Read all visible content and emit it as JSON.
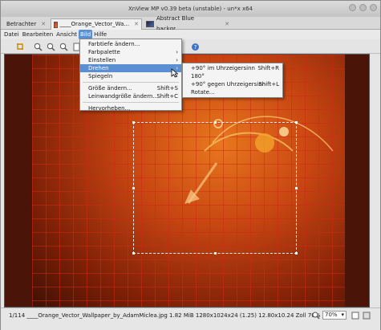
{
  "window": {
    "title": "XnView MP v0.39 beta (unstable) - un*x x64"
  },
  "tabs": [
    {
      "label": "Betrachter",
      "close": "✕"
    },
    {
      "label": "____Orange_Vector_Wa...",
      "close": "✕"
    },
    {
      "label": "Abstract Blue backgr...",
      "close": "✕"
    }
  ],
  "menubar": [
    "Datei",
    "Bearbeiten",
    "Ansicht",
    "Bild",
    "Hilfe"
  ],
  "image_menu": {
    "items": [
      {
        "label": "Farbtiefe ändern..."
      },
      {
        "label": "Farbpalette",
        "arrow": "›"
      },
      {
        "label": "Einstellen",
        "arrow": "›"
      },
      {
        "label": "Drehen",
        "arrow": "›"
      },
      {
        "label": "Spiegeln",
        "arrow": "›"
      },
      {
        "label": "Größe ändern...",
        "shortcut": "Shift+S"
      },
      {
        "label": "Leinwandgröße ändern...",
        "shortcut": "Shift+C"
      },
      {
        "label": "Hervorheben..."
      }
    ]
  },
  "rotate_submenu": {
    "items": [
      {
        "label": "+90° im Uhrzeigersinn",
        "shortcut": "Shift+R"
      },
      {
        "label": "180°",
        "shortcut": ""
      },
      {
        "label": "+90° gegen Uhrzeigersinn",
        "shortcut": "Shift+L"
      },
      {
        "label": "Rotate...",
        "shortcut": ""
      }
    ]
  },
  "status": {
    "text": "1/114   ____Orange_Vector_Wallpaper_by_AdamMiclea.jpg   1.82 MiB   1280x1024x24 (1.25)   12.80x10.24 Zoll   70%",
    "zoom": "70%",
    "zoom_arrow": "▾"
  },
  "icons": [
    "window-close-icon",
    "zoom-in-icon",
    "zoom-out-icon",
    "fit-icon",
    "help-icon"
  ],
  "colors": {
    "accent": "#5b8fd4",
    "art": "#c84612"
  }
}
